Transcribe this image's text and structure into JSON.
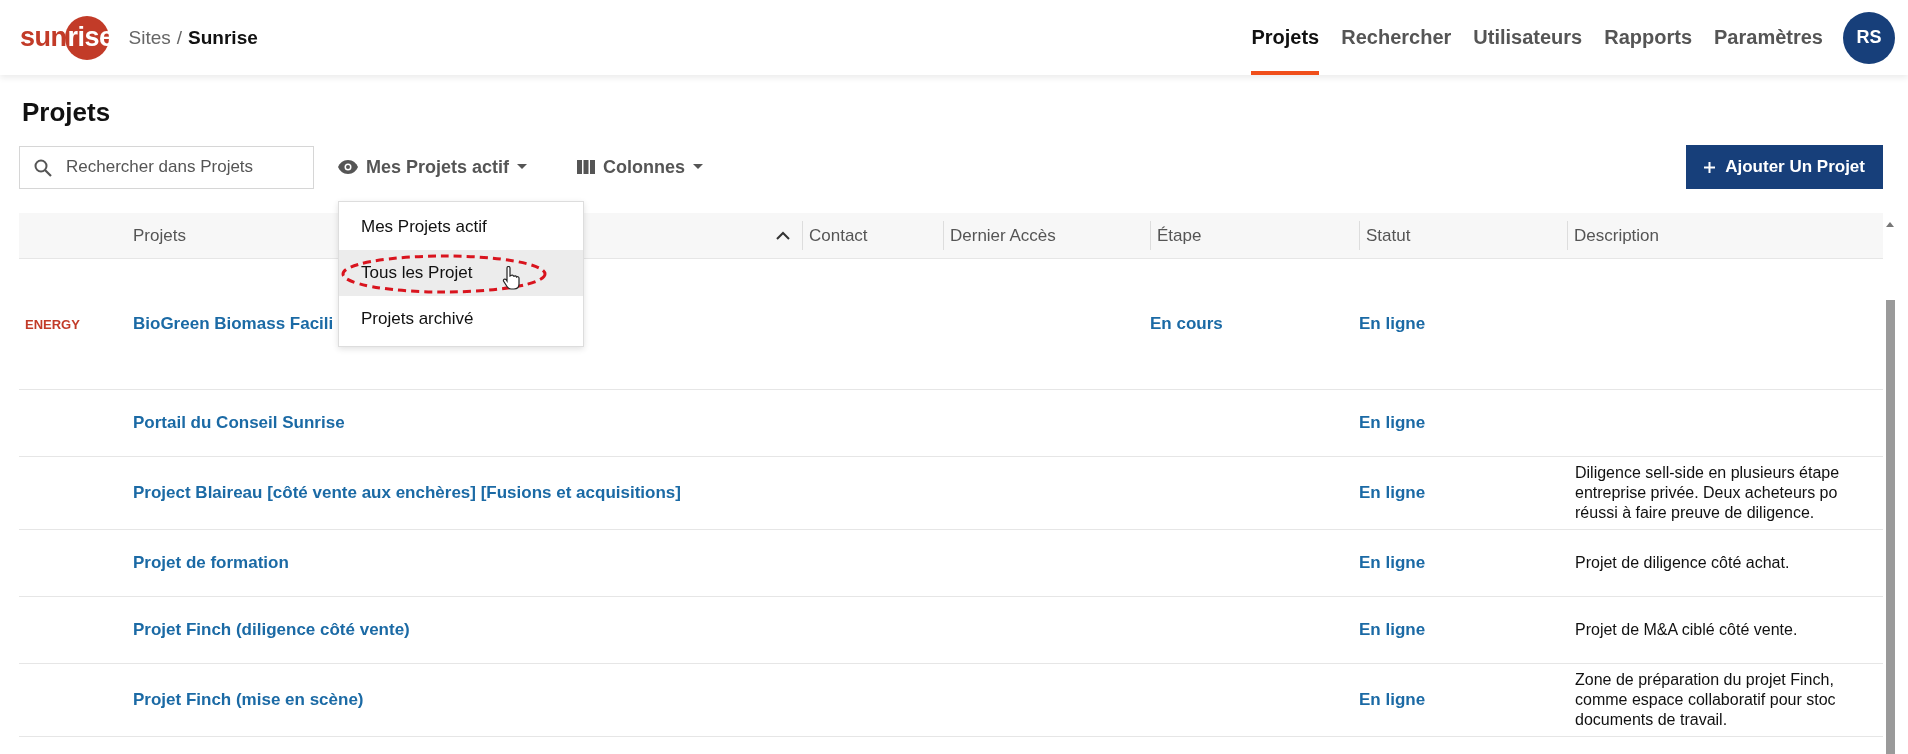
{
  "header": {
    "logo": {
      "plain": "sun",
      "on_circle": "rise"
    },
    "breadcrumb": [
      {
        "label": "Sites",
        "current": false
      },
      {
        "label": "Sunrise",
        "current": true
      }
    ],
    "separator": "/",
    "nav": [
      {
        "label": "Projets",
        "selected": true
      },
      {
        "label": "Rechercher",
        "selected": false
      },
      {
        "label": "Utilisateurs",
        "selected": false
      },
      {
        "label": "Rapports",
        "selected": false
      },
      {
        "label": "Paramètres",
        "selected": false
      }
    ],
    "avatar": "RS"
  },
  "page_title": "Projets",
  "toolbar": {
    "search": {
      "placeholder": "Rechercher dans Projets"
    },
    "view_filter": {
      "label": "Mes Projets actif",
      "options": [
        {
          "label": "Mes Projets actif",
          "highlighted": false,
          "annotated": false
        },
        {
          "label": "Tous les Projet",
          "highlighted": true,
          "annotated": true
        },
        {
          "label": "Projets archivé",
          "highlighted": false,
          "annotated": false
        }
      ]
    },
    "columns_button": "Colonnes",
    "add_button": "Ajouter Un Projet"
  },
  "table": {
    "columns": [
      {
        "label": "Projets",
        "sorted": true
      },
      {
        "label": "Contact",
        "sorted": false
      },
      {
        "label": "Dernier Accès",
        "sorted": false
      },
      {
        "label": "Étape",
        "sorted": false
      },
      {
        "label": "Statut",
        "sorted": false
      },
      {
        "label": "Description",
        "sorted": false
      }
    ],
    "rows": [
      {
        "logo": "ENERGY",
        "name": "BioGreen Biomass Facili",
        "stage": "En cours",
        "status": "En ligne"
      },
      {
        "name": "Portail du Conseil Sunrise",
        "status": "En ligne"
      },
      {
        "name": "Project Blaireau [côté vente aux enchères] [Fusions et acquisitions]",
        "status": "En ligne",
        "description": [
          "Diligence sell-side en plusieurs étape",
          "entreprise privée. Deux acheteurs po",
          "réussi à faire preuve de diligence."
        ]
      },
      {
        "name": "Projet de formation",
        "status": "En ligne",
        "description": [
          "Projet de diligence côté achat."
        ]
      },
      {
        "name": "Projet Finch (diligence côté vente)",
        "status": "En ligne",
        "description": [
          "Projet de M&A ciblé côté vente."
        ]
      },
      {
        "name": "Projet Finch (mise en scène)",
        "status": "En ligne",
        "description": [
          "Zone de préparation du projet Finch,",
          "comme espace collaboratif pour stoc",
          "documents de travail."
        ]
      }
    ]
  }
}
